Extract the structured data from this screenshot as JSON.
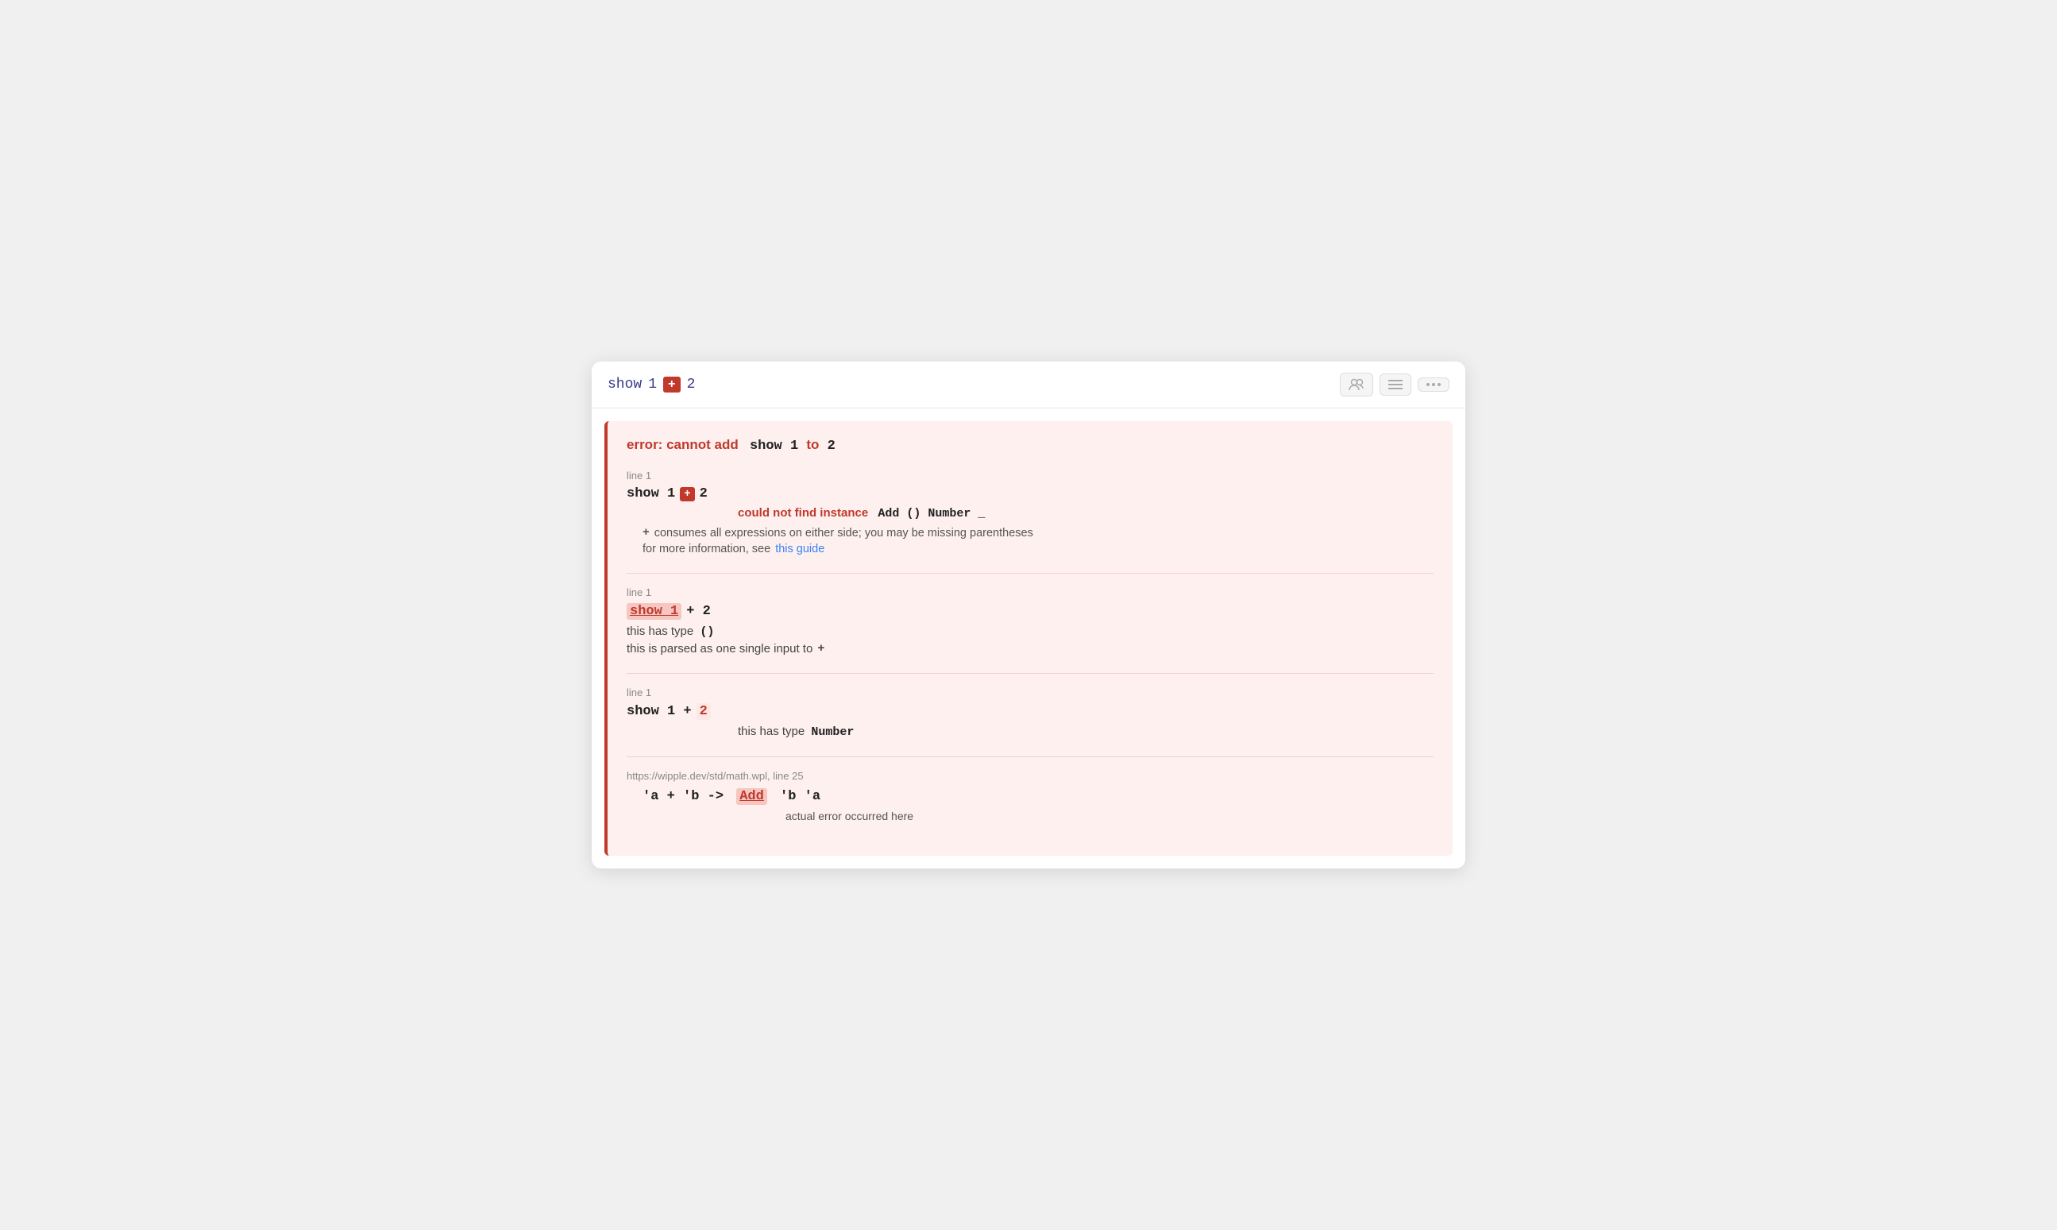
{
  "toolbar": {
    "code": {
      "show": "show",
      "num1": "1",
      "plus": "+",
      "num2": "2"
    },
    "buttons": {
      "users": "users-icon",
      "lines": "lines-icon",
      "more": "more-icon"
    }
  },
  "error": {
    "title_prefix": "error: cannot add",
    "title_code": "show 1",
    "title_to": "to",
    "title_num": "2",
    "sections": [
      {
        "id": "section1",
        "line_label": "line 1",
        "code_prefix": "show 1",
        "code_op": "+",
        "code_suffix": "2",
        "highlight": "plus",
        "message1_prefix": "could not find instance",
        "message1_code": "Add () Number _",
        "hint_op": "+",
        "hint_text": "consumes all expressions on either side; you may be missing parentheses",
        "hint_link_text": "this guide",
        "hint_prefix": "for more information, see"
      },
      {
        "id": "section2",
        "line_label": "line 1",
        "code_highlight": "show 1",
        "code_rest": "+ 2",
        "this_has_type": "this has type",
        "this_has_type_val": "()",
        "parsed_as": "this is parsed as one single input to",
        "parsed_op": "+"
      },
      {
        "id": "section3",
        "line_label": "line 1",
        "code_prefix": "show 1 +",
        "code_highlight": "2",
        "this_has_type": "this has type",
        "this_has_type_val": "Number"
      },
      {
        "id": "section4",
        "source_url": "https://wipple.dev/std/math.wpl, line 25",
        "code_line": "'a + 'b ->",
        "code_highlight": "Add",
        "code_suffix": "'b 'a",
        "actual_error": "actual error occurred here"
      }
    ]
  }
}
